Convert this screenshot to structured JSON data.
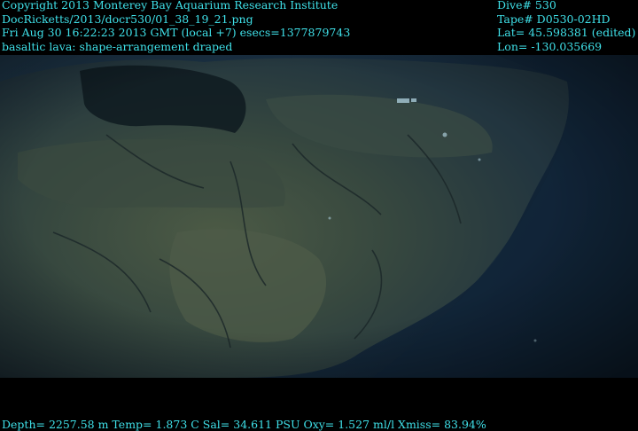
{
  "overlay": {
    "copyright": "Copyright 2013 Monterey Bay Aquarium Research Institute",
    "image_path": "DocRicketts/2013/docr530/01_38_19_21.png",
    "datetime": "Fri Aug 30 16:22:23 2013 GMT (local +7)  esecs=1377879743",
    "description": "basaltic lava: shape-arrangement draped",
    "dive": "Dive# 530",
    "tape": "Tape# D0530-02HD",
    "lat": "Lat= 45.598381 (edited)",
    "lon": "Lon= -130.035669",
    "telemetry": "Depth= 2257.58 m  Temp= 1.873 C  Sal= 34.611 PSU  Oxy= 1.527 ml/l  Xmiss= 83.94%"
  },
  "colors": {
    "overlay_text": "#3fe0e8",
    "water": "#14293b",
    "rock": "#3a4a3e"
  },
  "scene": {
    "subject": "seafloor-basaltic-lava-outcrop"
  }
}
